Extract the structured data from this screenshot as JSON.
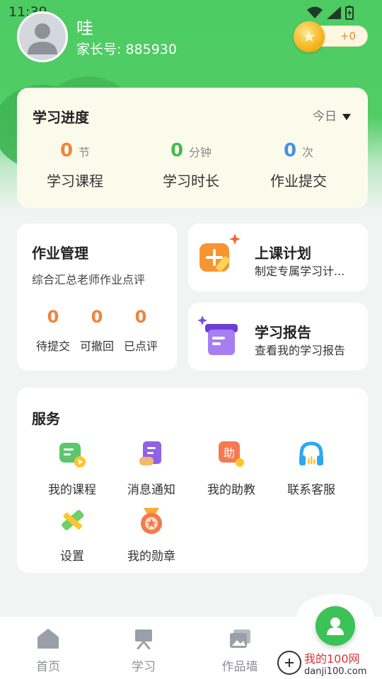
{
  "status_bar": {
    "time": "11:39"
  },
  "profile": {
    "name": "哇",
    "parent_id": "家长号: 885930",
    "coins": "+0"
  },
  "progress": {
    "title": "学习进度",
    "filter": "今日",
    "stats": [
      {
        "value": "0",
        "unit": "节",
        "label": "学习课程",
        "color": "#f0843d"
      },
      {
        "value": "0",
        "unit": "分钟",
        "label": "学习时长",
        "color": "#4ab84e"
      },
      {
        "value": "0",
        "unit": "次",
        "label": "作业提交",
        "color": "#4a90e2"
      }
    ]
  },
  "homework": {
    "title": "作业管理",
    "desc": "综合汇总老师作业点评",
    "stats": [
      {
        "value": "0",
        "label": "待提交"
      },
      {
        "value": "0",
        "label": "可撤回"
      },
      {
        "value": "0",
        "label": "已点评"
      }
    ]
  },
  "plan": {
    "title": "上课计划",
    "desc": "制定专属学习计..."
  },
  "report": {
    "title": "学习报告",
    "desc": "查看我的学习报告"
  },
  "services": {
    "title": "服务",
    "items": [
      {
        "label": "我的课程",
        "icon": "course-icon"
      },
      {
        "label": "消息通知",
        "icon": "notice-icon"
      },
      {
        "label": "我的助教",
        "icon": "assistant-icon"
      },
      {
        "label": "联系客服",
        "icon": "headset-icon"
      },
      {
        "label": "设置",
        "icon": "ruler-pencil-icon"
      },
      {
        "label": "我的勋章",
        "icon": "medal-icon"
      }
    ]
  },
  "tabs": [
    {
      "label": "首页",
      "icon": "home-icon"
    },
    {
      "label": "学习",
      "icon": "easel-icon"
    },
    {
      "label": "作品墙",
      "icon": "gallery-icon"
    }
  ],
  "watermark": {
    "text": "danji100.com",
    "cn": "我的100网"
  }
}
